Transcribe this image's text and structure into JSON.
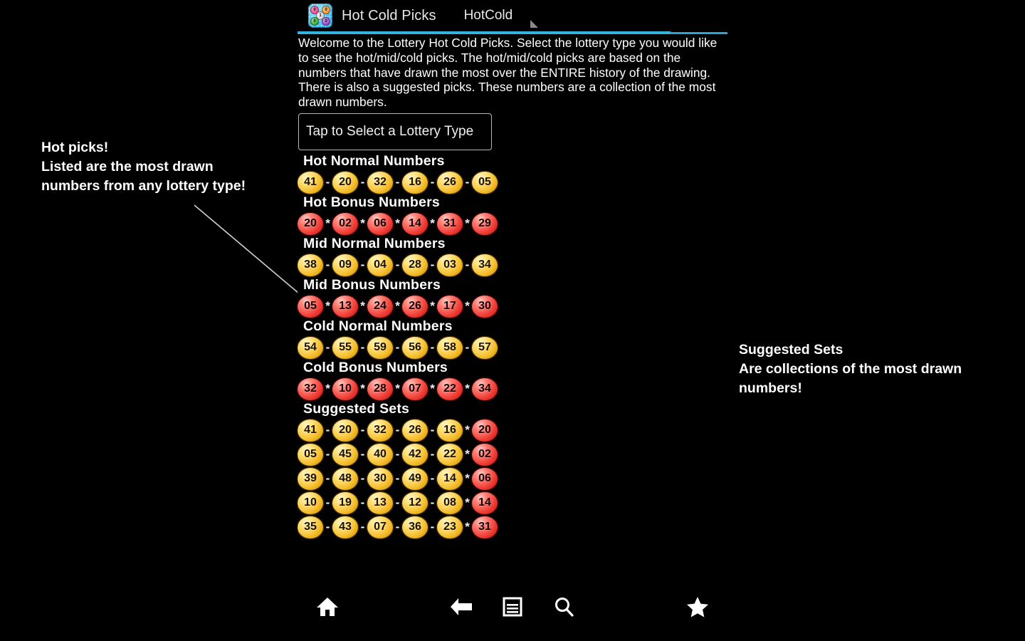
{
  "app": {
    "icon_name": "lottery-balls-app-icon",
    "title": "Hot Cold Picks",
    "subtitle": "HotCold",
    "accent_color": "#33b5e5",
    "background_color": "#000000"
  },
  "welcome": {
    "text": "Welcome to the Lottery Hot Cold Picks. Select the lottery type you would like to see the hot/mid/cold picks. The hot/mid/cold picks are based on the numbers that have drawn the most over the ENTIRE history of the drawing. There is also a suggested picks. These numbers are a collection of the most drawn numbers."
  },
  "select_button": {
    "label": "Tap to Select a Lottery Type"
  },
  "sections": [
    {
      "heading": "Hot Normal Numbers",
      "ball_color": "gold",
      "separator": "-",
      "numbers": [
        "41",
        "20",
        "32",
        "16",
        "26",
        "05"
      ]
    },
    {
      "heading": "Hot Bonus Numbers",
      "ball_color": "red",
      "separator": "*",
      "numbers": [
        "20",
        "02",
        "06",
        "14",
        "31",
        "29"
      ]
    },
    {
      "heading": "Mid Normal Numbers",
      "ball_color": "gold",
      "separator": "-",
      "numbers": [
        "38",
        "09",
        "04",
        "28",
        "03",
        "34"
      ]
    },
    {
      "heading": "Mid Bonus Numbers",
      "ball_color": "red",
      "separator": "*",
      "numbers": [
        "05",
        "13",
        "24",
        "26",
        "17",
        "30"
      ]
    },
    {
      "heading": "Cold Normal Numbers",
      "ball_color": "gold",
      "separator": "-",
      "numbers": [
        "54",
        "55",
        "59",
        "56",
        "58",
        "57"
      ]
    },
    {
      "heading": "Cold Bonus Numbers",
      "ball_color": "red",
      "separator": "*",
      "numbers": [
        "32",
        "10",
        "28",
        "07",
        "22",
        "34"
      ]
    }
  ],
  "suggested": {
    "heading": "Suggested Sets",
    "normal_separator": "-",
    "bonus_separator": "*",
    "sets": [
      {
        "normals": [
          "41",
          "20",
          "32",
          "26",
          "16"
        ],
        "bonus": "20"
      },
      {
        "normals": [
          "05",
          "45",
          "40",
          "42",
          "22"
        ],
        "bonus": "02"
      },
      {
        "normals": [
          "39",
          "48",
          "30",
          "49",
          "14"
        ],
        "bonus": "06"
      },
      {
        "normals": [
          "10",
          "19",
          "13",
          "12",
          "08"
        ],
        "bonus": "14"
      },
      {
        "normals": [
          "35",
          "43",
          "07",
          "36",
          "23"
        ],
        "bonus": "31"
      }
    ]
  },
  "nav": {
    "items": [
      {
        "icon": "home-icon",
        "label": "Home"
      },
      {
        "icon": "back-icon",
        "label": "Back"
      },
      {
        "icon": "menu-icon",
        "label": "Menu"
      },
      {
        "icon": "search-icon",
        "label": "Search"
      },
      {
        "icon": "star-icon",
        "label": "Favorite"
      }
    ]
  },
  "annotations": {
    "left": "Hot picks!\nListed are the most drawn\nnumbers from any lottery type!",
    "right": "Suggested Sets\nAre collections of the most drawn\nnumbers!"
  }
}
